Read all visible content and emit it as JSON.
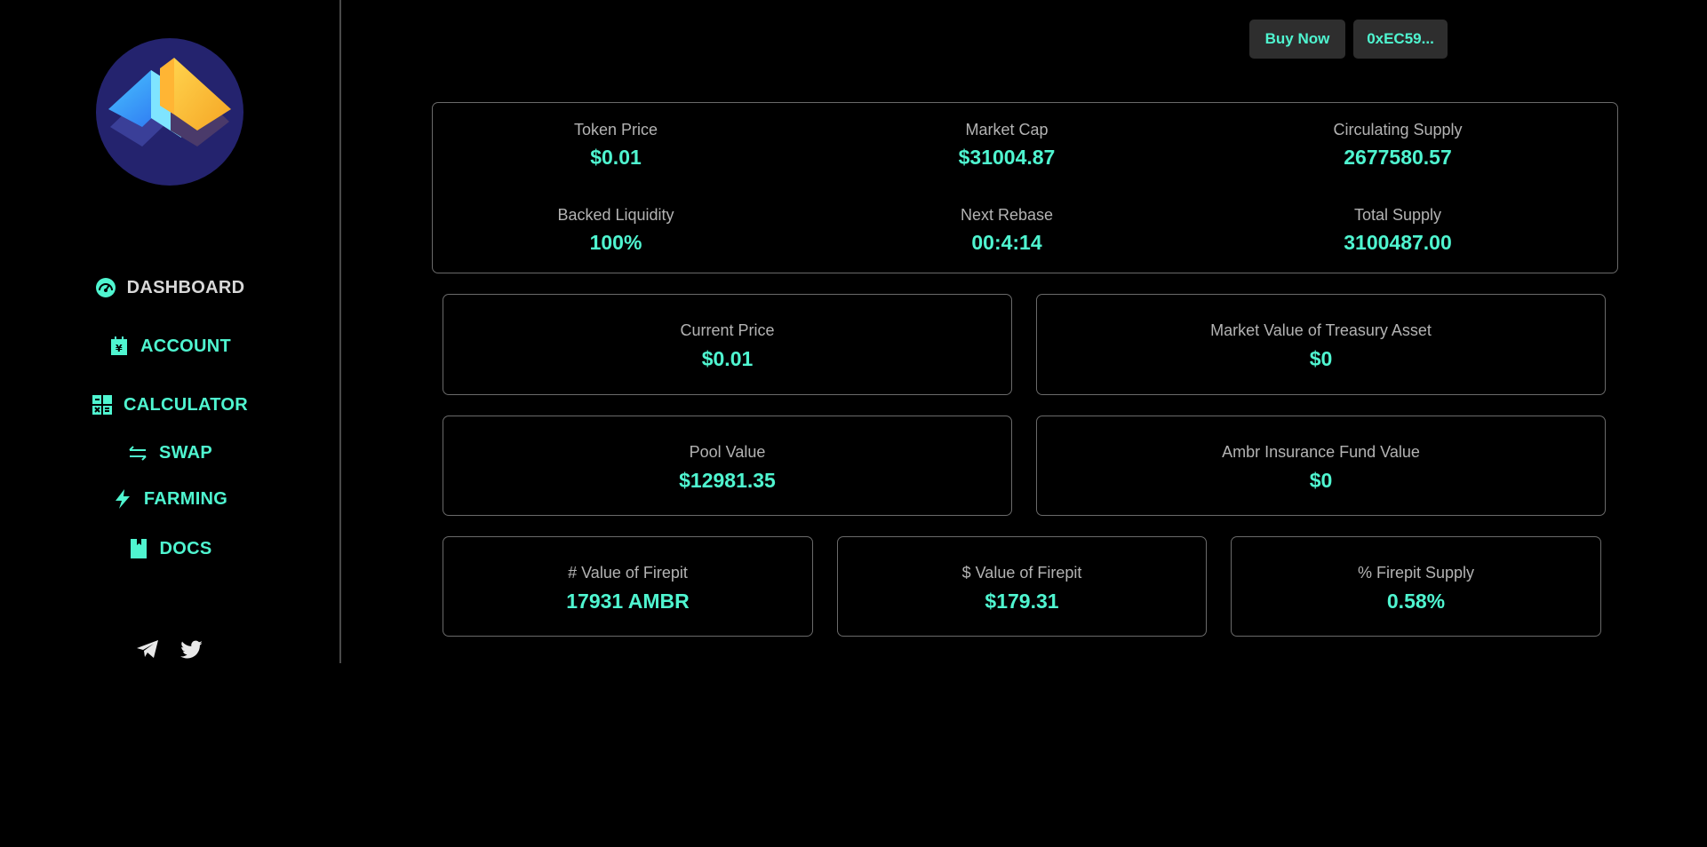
{
  "header": {
    "buy_now": "Buy Now",
    "wallet": "0xEC59..."
  },
  "sidebar": {
    "logo": "brand-logo",
    "items": [
      {
        "label": "DASHBOARD",
        "icon": "dashboard-gauge-icon",
        "active": true
      },
      {
        "label": "ACCOUNT",
        "icon": "account-yen-icon",
        "active": false
      },
      {
        "label": "CALCULATOR",
        "icon": "calculator-icon",
        "active": false
      },
      {
        "label": "SWAP",
        "icon": "swap-arrows-icon",
        "active": false
      },
      {
        "label": "FARMING",
        "icon": "lightning-icon",
        "active": false
      },
      {
        "label": "DOCS",
        "icon": "book-icon",
        "active": false
      }
    ],
    "social": [
      "telegram-icon",
      "twitter-icon"
    ]
  },
  "overview": {
    "token_price": {
      "label": "Token Price",
      "value": "$0.01"
    },
    "market_cap": {
      "label": "Market Cap",
      "value": "$31004.87"
    },
    "circulating_supply": {
      "label": "Circulating Supply",
      "value": "2677580.57"
    },
    "backed_liquidity": {
      "label": "Backed Liquidity",
      "value": "100%"
    },
    "next_rebase": {
      "label": "Next Rebase",
      "value": "00:4:14"
    },
    "total_supply": {
      "label": "Total Supply",
      "value": "3100487.00"
    }
  },
  "cards": {
    "current_price": {
      "label": "Current Price",
      "value": "$0.01"
    },
    "treasury": {
      "label": "Market Value of Treasury Asset",
      "value": "$0"
    },
    "pool_value": {
      "label": "Pool Value",
      "value": "$12981.35"
    },
    "insurance": {
      "label": "Ambr Insurance Fund Value",
      "value": "$0"
    },
    "firepit_count": {
      "label": "# Value of Firepit",
      "value": "17931 AMBR"
    },
    "firepit_usd": {
      "label": "$ Value of Firepit",
      "value": "$179.31"
    },
    "firepit_pct": {
      "label": "% Firepit Supply",
      "value": "0.58%"
    }
  },
  "colors": {
    "accent": "#4ff5d0",
    "background": "#000000",
    "label": "#b3b3b3",
    "border": "#6a6a6a",
    "button_bg": "#2e2e2e"
  }
}
